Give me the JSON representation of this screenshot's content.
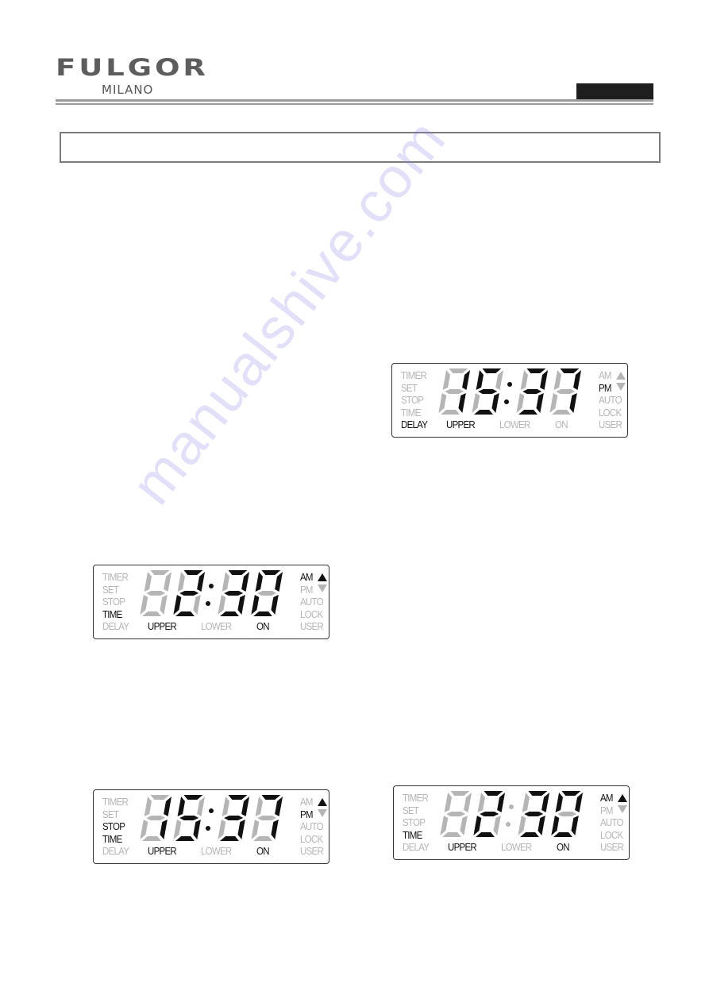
{
  "header": {
    "brand": "FULGOR",
    "brand_sub": "MILANO",
    "section_tab": ""
  },
  "title_box": {
    "text": ""
  },
  "colors": {
    "lit": "#111111",
    "unlit": "#b5b5b5",
    "rule": "#9a9a9a",
    "tab": "#1e1e1e"
  },
  "displays": [
    {
      "id": "display-delay-1537",
      "digits": [
        "1",
        "5",
        "3",
        "7"
      ],
      "colon_lit": true,
      "left_labels": [
        {
          "text": "TIMER",
          "lit": false
        },
        {
          "text": "SET",
          "lit": false
        },
        {
          "text": "STOP",
          "lit": false
        },
        {
          "text": "TIME",
          "lit": false
        },
        {
          "text": "DELAY",
          "lit": true
        }
      ],
      "bottom_labels": [
        {
          "text": "UPPER",
          "lit": true
        },
        {
          "text": "LOWER",
          "lit": false
        },
        {
          "text": "ON",
          "lit": false
        }
      ],
      "right_labels": [
        {
          "text": "AM",
          "lit": false
        },
        {
          "text": "PM",
          "lit": true
        },
        {
          "text": "AUTO",
          "lit": false
        },
        {
          "text": "LOCK",
          "lit": false
        },
        {
          "text": "USER",
          "lit": false
        }
      ],
      "arrow_up_lit": false,
      "arrow_down_lit": false
    },
    {
      "id": "display-time-230",
      "digits": [
        "",
        "2",
        "3",
        "0"
      ],
      "colon_lit": true,
      "left_labels": [
        {
          "text": "TIMER",
          "lit": false
        },
        {
          "text": "SET",
          "lit": false
        },
        {
          "text": "STOP",
          "lit": false
        },
        {
          "text": "TIME",
          "lit": true
        },
        {
          "text": "DELAY",
          "lit": false
        }
      ],
      "bottom_labels": [
        {
          "text": "UPPER",
          "lit": true
        },
        {
          "text": "LOWER",
          "lit": false
        },
        {
          "text": "ON",
          "lit": true
        }
      ],
      "right_labels": [
        {
          "text": "AM",
          "lit": true
        },
        {
          "text": "PM",
          "lit": false
        },
        {
          "text": "AUTO",
          "lit": false
        },
        {
          "text": "LOCK",
          "lit": false
        },
        {
          "text": "USER",
          "lit": false
        }
      ],
      "arrow_up_lit": true,
      "arrow_down_lit": false
    },
    {
      "id": "display-stop-time-1537",
      "digits": [
        "1",
        "5",
        "3",
        "7"
      ],
      "colon_lit": true,
      "left_labels": [
        {
          "text": "TIMER",
          "lit": false
        },
        {
          "text": "SET",
          "lit": false
        },
        {
          "text": "STOP",
          "lit": true
        },
        {
          "text": "TIME",
          "lit": true
        },
        {
          "text": "DELAY",
          "lit": false
        }
      ],
      "bottom_labels": [
        {
          "text": "UPPER",
          "lit": true
        },
        {
          "text": "LOWER",
          "lit": false
        },
        {
          "text": "ON",
          "lit": true
        }
      ],
      "right_labels": [
        {
          "text": "AM",
          "lit": false
        },
        {
          "text": "PM",
          "lit": true
        },
        {
          "text": "AUTO",
          "lit": false
        },
        {
          "text": "LOCK",
          "lit": false
        },
        {
          "text": "USER",
          "lit": false
        }
      ],
      "arrow_up_lit": true,
      "arrow_down_lit": false
    },
    {
      "id": "display-time-230-nocolon",
      "digits": [
        "",
        "2",
        "3",
        "0"
      ],
      "colon_lit": false,
      "left_labels": [
        {
          "text": "TIMER",
          "lit": false
        },
        {
          "text": "SET",
          "lit": false
        },
        {
          "text": "STOP",
          "lit": false
        },
        {
          "text": "TIME",
          "lit": true
        },
        {
          "text": "DELAY",
          "lit": false
        }
      ],
      "bottom_labels": [
        {
          "text": "UPPER",
          "lit": true
        },
        {
          "text": "LOWER",
          "lit": false
        },
        {
          "text": "ON",
          "lit": true
        }
      ],
      "right_labels": [
        {
          "text": "AM",
          "lit": true
        },
        {
          "text": "PM",
          "lit": false
        },
        {
          "text": "AUTO",
          "lit": false
        },
        {
          "text": "LOCK",
          "lit": false
        },
        {
          "text": "USER",
          "lit": false
        }
      ],
      "arrow_up_lit": true,
      "arrow_down_lit": false
    }
  ],
  "watermark": "manualshive.com"
}
